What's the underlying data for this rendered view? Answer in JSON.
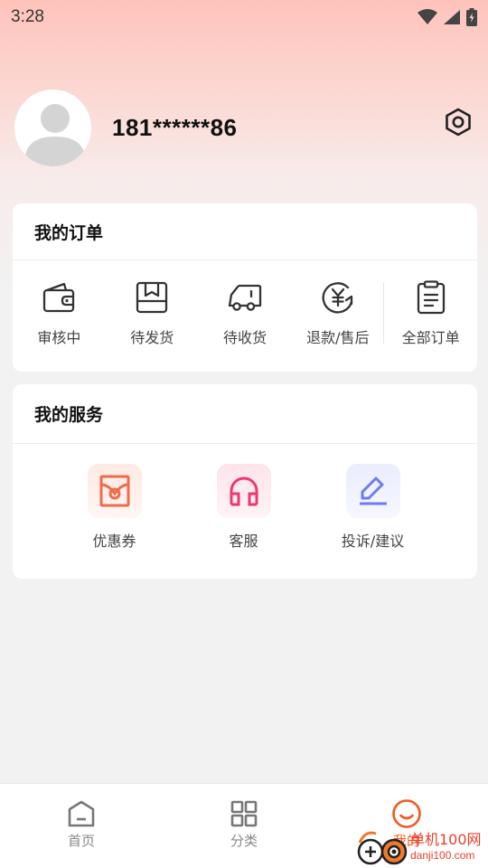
{
  "status_bar": {
    "time": "3:28"
  },
  "profile": {
    "phone": "181******86"
  },
  "orders": {
    "title": "我的订单",
    "items": [
      {
        "label": "审核中",
        "icon": "wallet-icon"
      },
      {
        "label": "待发货",
        "icon": "package-icon"
      },
      {
        "label": "待收货",
        "icon": "truck-icon"
      },
      {
        "label": "退款/售后",
        "icon": "yen-refund-icon"
      },
      {
        "label": "全部订单",
        "icon": "clipboard-icon"
      }
    ]
  },
  "services": {
    "title": "我的服务",
    "items": [
      {
        "label": "优惠券",
        "icon": "coupon-icon",
        "color": "#f06b4a",
        "bg": "#fdebe6"
      },
      {
        "label": "客服",
        "icon": "headset-icon",
        "color": "#f0366d",
        "bg": "#fde6ec"
      },
      {
        "label": "投诉/建议",
        "icon": "edit-pen-icon",
        "color": "#6d7df0",
        "bg": "#ebeefd"
      }
    ]
  },
  "tabbar": {
    "items": [
      {
        "label": "首页",
        "icon": "home-icon",
        "active": false
      },
      {
        "label": "分类",
        "icon": "grid-icon",
        "active": false
      },
      {
        "label": "我的",
        "icon": "smile-icon",
        "active": true
      }
    ]
  },
  "watermark": {
    "main": "单机100网",
    "sub": "danji100.com"
  },
  "colors": {
    "accent": "#f4561e",
    "order_icon": "#333333"
  }
}
